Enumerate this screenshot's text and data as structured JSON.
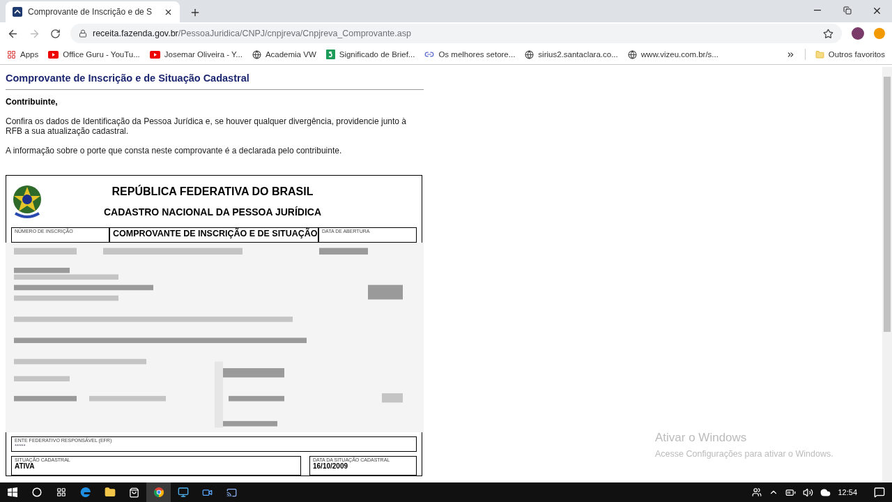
{
  "browser": {
    "tab": {
      "title": "Comprovante de Inscrição e de S",
      "selected": true
    },
    "url": {
      "domain": "receita.fazenda.gov.br",
      "path": "/PessoaJuridica/CNPJ/cnpjreva/Cnpjreva_Comprovante.asp"
    },
    "bookmarks": [
      {
        "label": "Apps",
        "kind": "apps"
      },
      {
        "label": "Office Guru - YouTu...",
        "kind": "youtube"
      },
      {
        "label": "Josemar Oliveira - Y...",
        "kind": "youtube"
      },
      {
        "label": "Academia VW",
        "kind": "globe"
      },
      {
        "label": "Significado de Brief...",
        "kind": "sheet"
      },
      {
        "label": "Os melhores setore...",
        "kind": "link"
      },
      {
        "label": "sirius2.santaclara.co...",
        "kind": "globe"
      },
      {
        "label": "www.vizeu.com.br/s...",
        "kind": "globe"
      }
    ],
    "other_bookmarks": "Outros favoritos"
  },
  "page": {
    "title": "Comprovante de Inscrição e de Situação Cadastral",
    "greeting": "Contribuinte,",
    "paragraphs": [
      "Confira os dados de Identificação da Pessoa Jurídica e, se houver qualquer divergência, providencie junto à RFB a sua atualização cadastral.",
      "A informação sobre o porte que consta neste comprovante é a declarada pelo contribuinte."
    ],
    "document": {
      "heading": "REPÚBLICA FEDERATIVA DO BRASIL",
      "subheading": "CADASTRO NACIONAL DA PESSOA JURÍDICA",
      "top_row": [
        {
          "label": "NÚMERO DE INSCRIÇÃO"
        },
        {
          "title": "COMPROVANTE DE INSCRIÇÃO E DE SITUAÇÃO"
        },
        {
          "label": "DATA DE ABERTURA"
        }
      ],
      "efr": {
        "label": "ENTE FEDERATIVO RESPONSÁVEL (EFR)",
        "value": "*****"
      },
      "status_row": [
        {
          "label": "SITUAÇÃO CADASTRAL",
          "value": "ATIVA"
        },
        {
          "label": "DATA DA SITUAÇÃO CADASTRAL",
          "value": "16/10/2009"
        }
      ]
    }
  },
  "windows_notice": {
    "title": "Ativar o Windows",
    "text": "Acesse Configurações para ativar o Windows."
  },
  "taskbar": {
    "apps": [
      {
        "kind": "edge",
        "selected": false
      },
      {
        "kind": "folder",
        "selected": false
      },
      {
        "kind": "store",
        "selected": false
      },
      {
        "kind": "chrome",
        "selected": true
      },
      {
        "kind": "monitor",
        "selected": false
      },
      {
        "kind": "video",
        "selected": false
      },
      {
        "kind": "remote",
        "selected": false
      }
    ],
    "clock": "12:54"
  }
}
